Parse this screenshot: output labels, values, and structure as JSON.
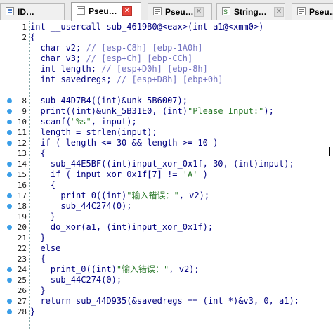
{
  "tabs": [
    {
      "label": "ID…",
      "icon": "ida-view-icon",
      "active": false
    },
    {
      "label": "Pseu…",
      "icon": "pseudocode-icon",
      "active": true
    },
    {
      "label": "Pseu…",
      "icon": "pseudocode-icon",
      "active": false
    },
    {
      "label": "String…",
      "icon": "strings-icon",
      "active": false
    },
    {
      "label": "Pseu…",
      "icon": "pseudocode-icon",
      "active": false
    }
  ],
  "close_glyph": "✕",
  "code": {
    "lines": [
      {
        "num": "1",
        "bp": false,
        "text": "int __usercall sub_4619B0@<eax>(int a1@<xmm0>)"
      },
      {
        "num": "2",
        "bp": false,
        "text": "{"
      },
      {
        "num": "",
        "bp": false,
        "text": "  char v2; // [esp-C8h] [ebp-1A0h]"
      },
      {
        "num": "",
        "bp": false,
        "text": "  char v3; // [esp+Ch] [ebp-CCh]"
      },
      {
        "num": "",
        "bp": false,
        "text": "  int length; // [esp+D0h] [ebp-8h]"
      },
      {
        "num": "",
        "bp": false,
        "text": "  int savedregs; // [esp+D8h] [ebp+0h]"
      },
      {
        "num": "",
        "bp": false,
        "text": ""
      },
      {
        "num": "8",
        "bp": true,
        "text": "  sub_44D7B4((int)&unk_5B6007);"
      },
      {
        "num": "9",
        "bp": true,
        "text": "  print((int)&unk_5B31E0, (int)\"Please Input:\");"
      },
      {
        "num": "10",
        "bp": true,
        "text": "  scanf(\"%s\", input);"
      },
      {
        "num": "11",
        "bp": true,
        "text": "  length = strlen(input);"
      },
      {
        "num": "12",
        "bp": true,
        "text": "  if ( length <= 30 && length >= 10 )"
      },
      {
        "num": "13",
        "bp": false,
        "text": "  {"
      },
      {
        "num": "14",
        "bp": true,
        "text": "    sub_44E5BF((int)input_xor_0x1f, 30, (int)input);"
      },
      {
        "num": "15",
        "bp": true,
        "text": "    if ( input_xor_0x1f[7] != 'A' )"
      },
      {
        "num": "16",
        "bp": false,
        "text": "    {"
      },
      {
        "num": "17",
        "bp": true,
        "text": "      print_0((int)\"输入错误：\", v2);"
      },
      {
        "num": "18",
        "bp": true,
        "text": "      sub_44C274(0);"
      },
      {
        "num": "19",
        "bp": false,
        "text": "    }"
      },
      {
        "num": "20",
        "bp": true,
        "text": "    do_xor(a1, (int)input_xor_0x1f);"
      },
      {
        "num": "21",
        "bp": false,
        "text": "  }"
      },
      {
        "num": "22",
        "bp": false,
        "text": "  else"
      },
      {
        "num": "23",
        "bp": false,
        "text": "  {"
      },
      {
        "num": "24",
        "bp": true,
        "text": "    print_0((int)\"输入错误：\", v2);"
      },
      {
        "num": "25",
        "bp": true,
        "text": "    sub_44C274(0);"
      },
      {
        "num": "26",
        "bp": false,
        "text": "  }"
      },
      {
        "num": "27",
        "bp": true,
        "text": "  return sub_44D935(&savedregs == (int *)&v3, 0, a1);"
      },
      {
        "num": "28",
        "bp": true,
        "text": "}"
      }
    ]
  },
  "colors": {
    "code_text": "#000080",
    "comment": "#7070c0",
    "string": "#2d7a2d",
    "breakpoint_dot": "#3a9ee8",
    "close_active": "#e8433a"
  }
}
